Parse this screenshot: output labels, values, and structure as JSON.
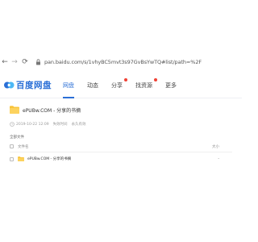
{
  "browser": {
    "url": "pan.baidu.com/s/1vhyBC5mvt3s97GvBsYwTQ#list/path=%2F",
    "back_label": "←",
    "forward_label": "→",
    "reload_label": "⟳"
  },
  "header": {
    "logo_text": "百度网盘",
    "nav": [
      {
        "label": "网盘"
      },
      {
        "label": "动态"
      },
      {
        "label": "分享"
      },
      {
        "label": "找资源"
      },
      {
        "label": "更多"
      }
    ]
  },
  "share": {
    "title": "ePUBw.COM - 分享的书摘",
    "date": "2019-10-22 12:09",
    "expire": "永久有效",
    "status": "失效时间"
  },
  "files": {
    "all_label": "全部文件",
    "col_name": "文件名",
    "col_size": "大小",
    "rows": [
      {
        "name": "ePUBw.COM - 分享的书摘",
        "size": "-"
      }
    ]
  },
  "colors": {
    "brand": "#2b6fd6",
    "folder": "#f8c43a"
  }
}
